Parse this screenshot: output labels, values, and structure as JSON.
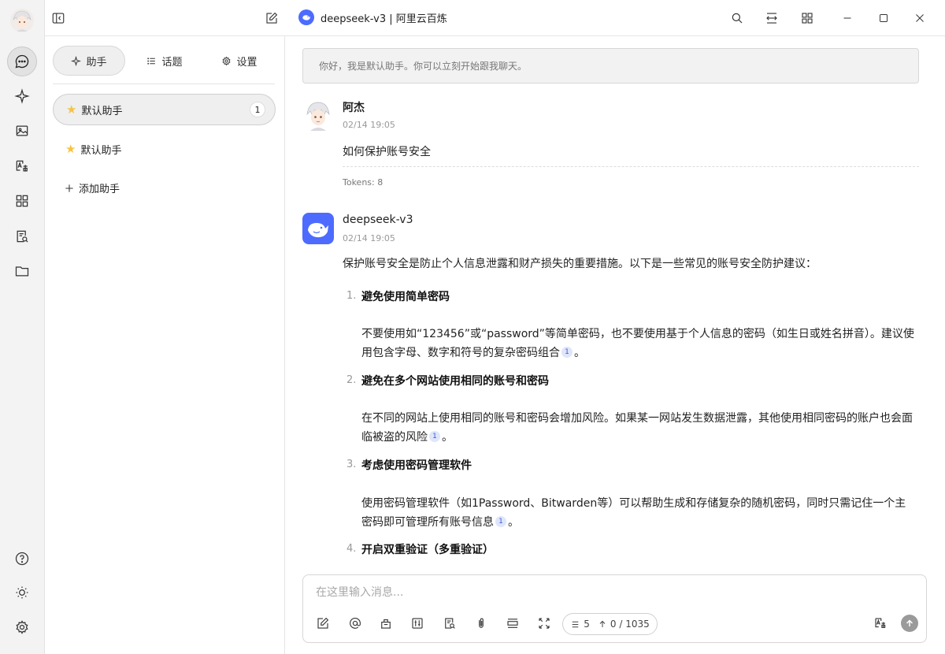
{
  "window": {
    "title": "deepseek-v3 | 阿里云百炼"
  },
  "panel": {
    "tabs": [
      {
        "label": "助手"
      },
      {
        "label": "话题"
      },
      {
        "label": "设置"
      }
    ],
    "assistants": [
      {
        "label": "默认助手",
        "count": "1"
      },
      {
        "label": "默认助手"
      }
    ],
    "add_label": "添加助手"
  },
  "chat": {
    "notice": "你好，我是默认助手。你可以立刻开始跟我聊天。",
    "user_message": {
      "name": "阿杰",
      "time": "02/14 19:05",
      "text": "如何保护账号安全",
      "tokens": "Tokens: 8"
    },
    "ai_message": {
      "name": "deepseek-v3",
      "time": "02/14 19:05",
      "intro": "保护账号安全是防止个人信息泄露和财产损失的重要措施。以下是一些常见的账号安全防护建议：",
      "items": [
        {
          "num": "1.",
          "title": "避免使用简单密码",
          "desc": "不要使用如“123456”或“password”等简单密码，也不要使用基于个人信息的密码（如生日或姓名拼音）。建议使用包含字母、数字和符号的复杂密码组合",
          "cite": "1",
          "end": "。"
        },
        {
          "num": "2.",
          "title": "避免在多个网站使用相同的账号和密码",
          "desc": "在不同的网站上使用相同的账号和密码会增加风险。如果某一网站发生数据泄露，其他使用相同密码的账户也会面临被盗的风险",
          "cite": "1",
          "end": "。"
        },
        {
          "num": "3.",
          "title": "考虑使用密码管理软件",
          "desc": "使用密码管理软件（如1Password、Bitwarden等）可以帮助生成和存储复杂的随机密码，同时只需记住一个主密码即可管理所有账号信息",
          "cite": "1",
          "end": "。"
        },
        {
          "num": "4.",
          "title": "开启双重验证（多重验证）"
        }
      ]
    }
  },
  "input": {
    "placeholder": "在这里输入消息...",
    "value": "",
    "context_count": "5",
    "token_usage": "0 / 1035"
  },
  "colors": {
    "accent": "#4d6bfe",
    "cite_bg": "#dfe6fb",
    "star": "#f6c344"
  }
}
